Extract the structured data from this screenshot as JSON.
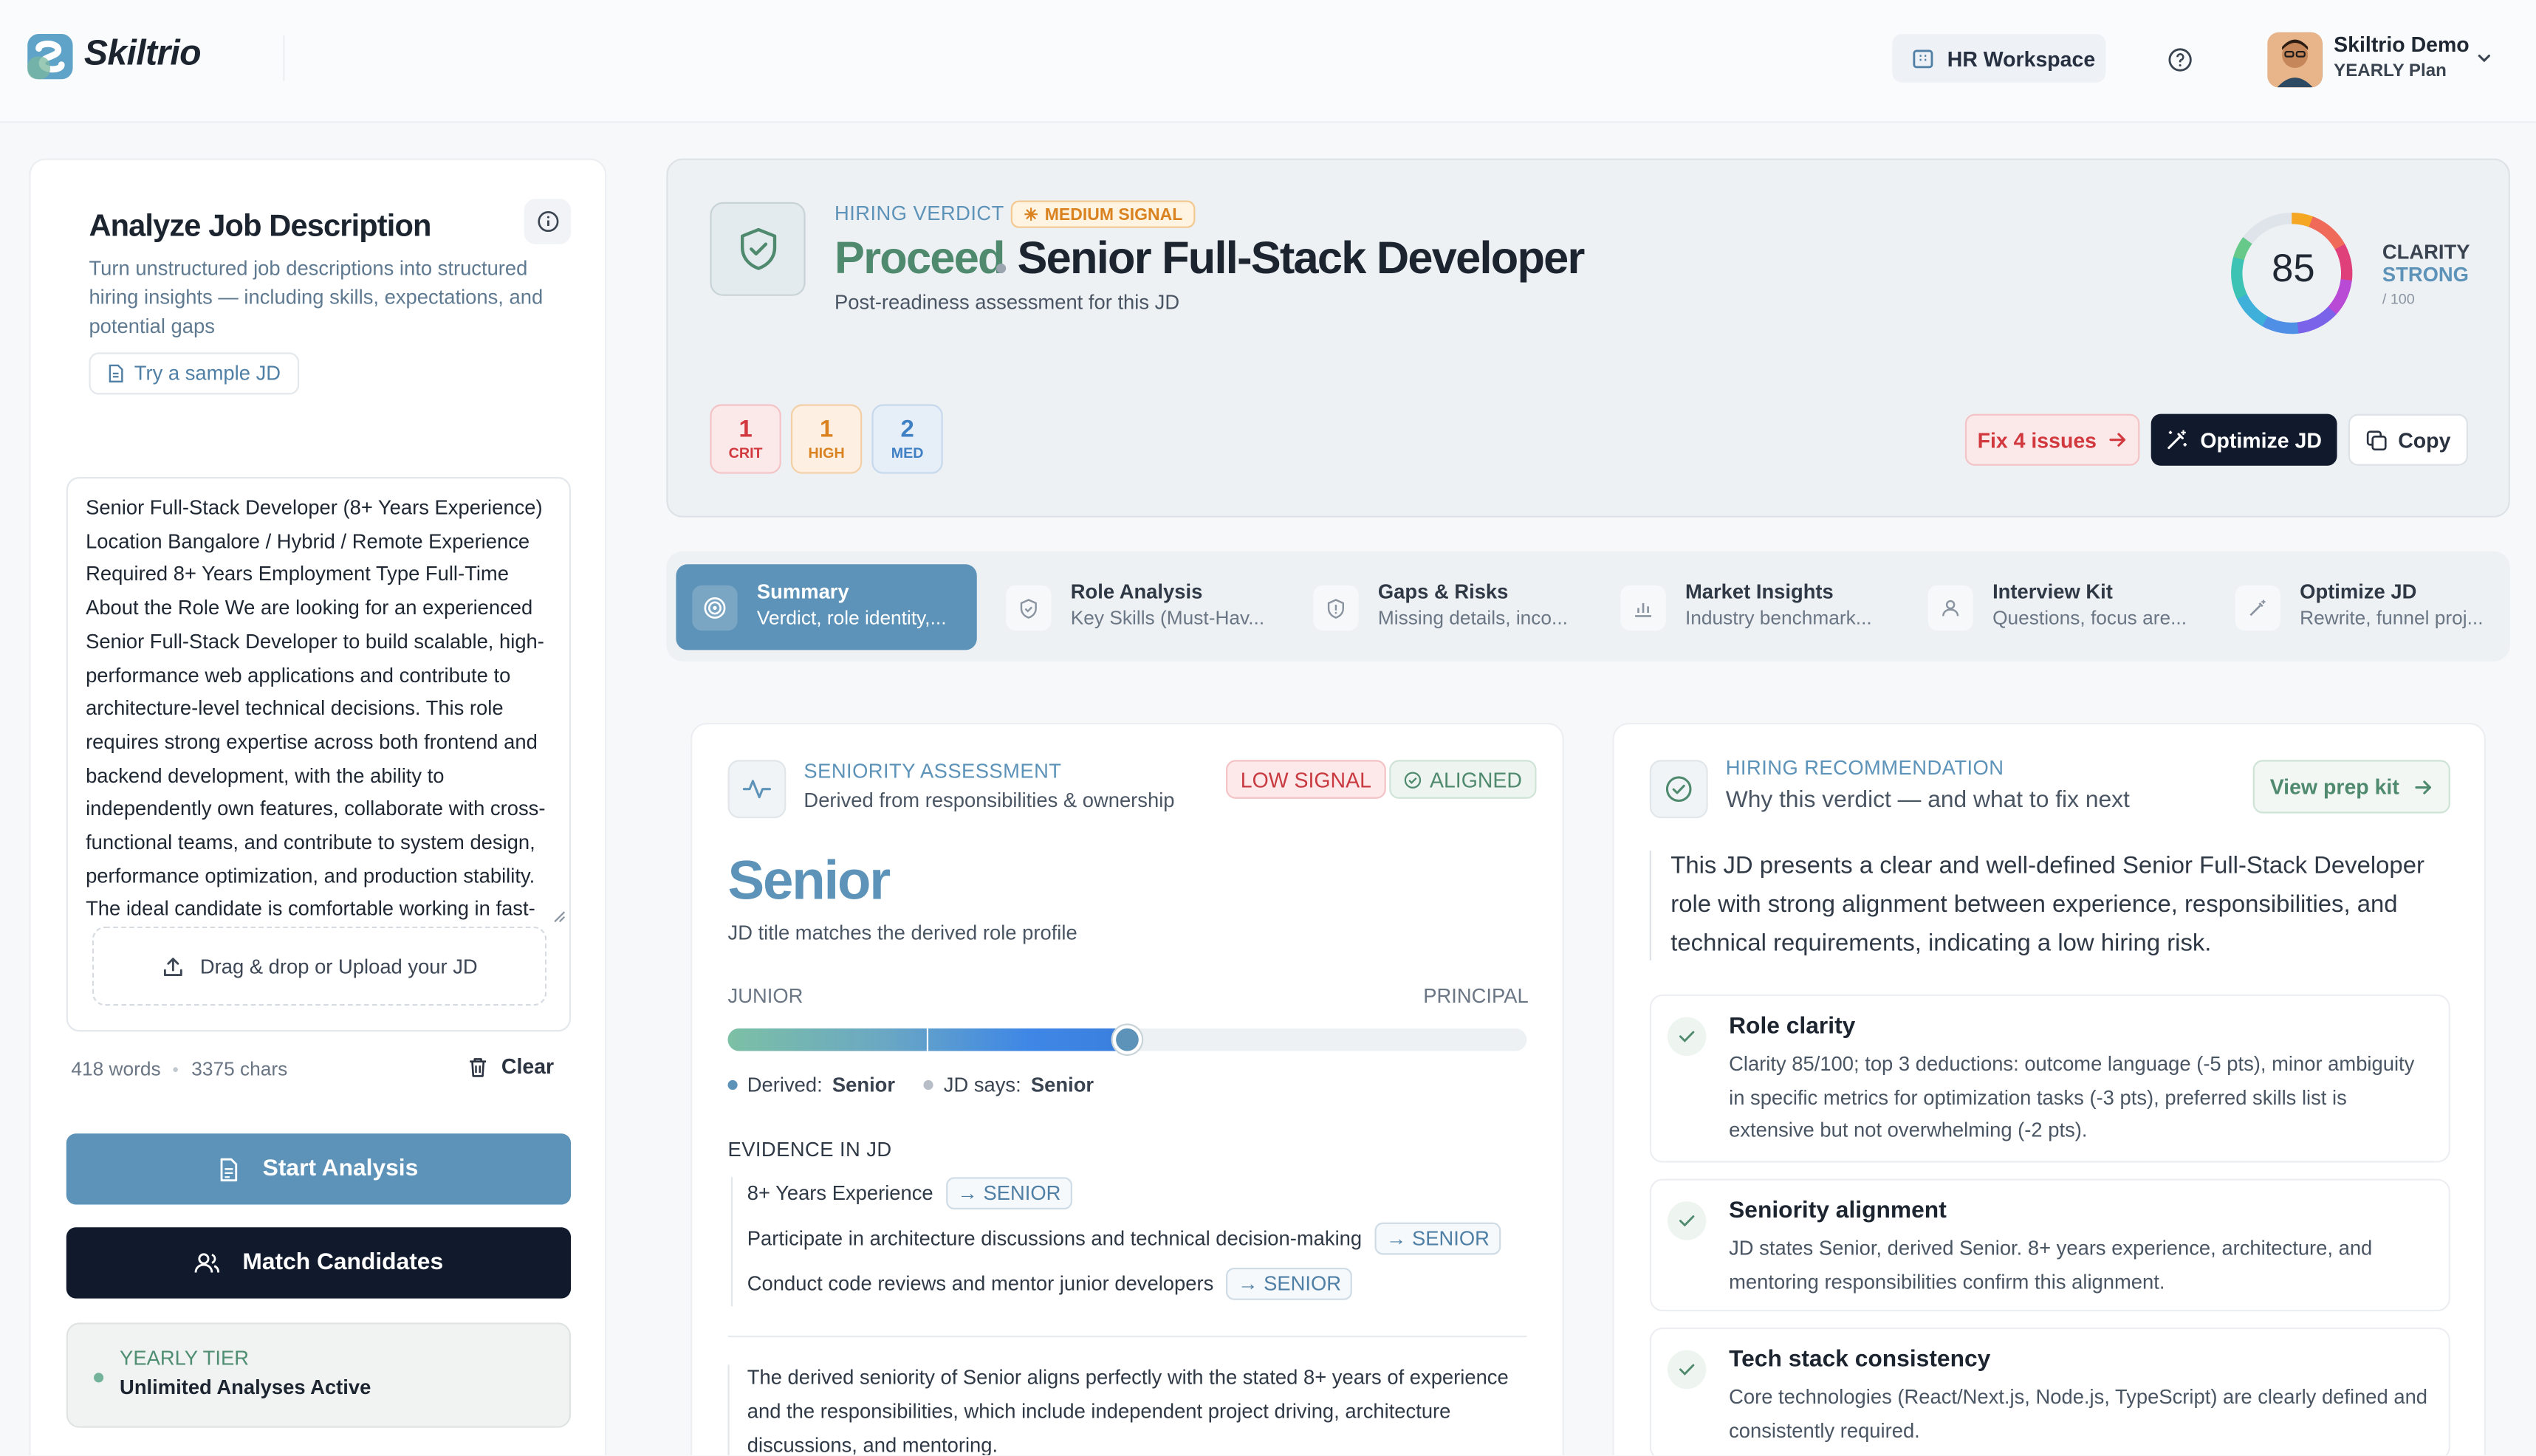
{
  "header": {
    "logo": "Skiltrio",
    "workspace_btn": "HR Workspace",
    "user_name": "Skiltrio Demo",
    "user_plan": "YEARLY Plan"
  },
  "left": {
    "title": "Analyze Job Description",
    "description": "Turn unstructured job descriptions into structured hiring insights — including skills, expectations, and potential gaps",
    "sample_btn": "Try a sample JD",
    "jd_text": "Senior Full-Stack Developer (8+ Years Experience) Location Bangalore / Hybrid / Remote Experience Required 8+ Years Employment Type Full-Time About the Role We are looking for an experienced Senior Full-Stack Developer to build scalable, high-performance web applications and contribute to architecture-level technical decisions. This role requires strong expertise across both frontend and backend development, with the ability to independently own features, collaborate with cross-functional teams, and contribute to system design, performance optimization, and production stability. The ideal candidate is comfortable working in fast-",
    "upload_label": "Drag & drop or Upload your JD",
    "word_count": "418 words",
    "char_count": "3375 chars",
    "clear_btn": "Clear",
    "start_btn": "Start Analysis",
    "match_btn": "Match Candidates",
    "tier_label": "YEARLY TIER",
    "tier_value": "Unlimited Analyses Active"
  },
  "verdict": {
    "label": "HIRING VERDICT",
    "signal": "MEDIUM SIGNAL",
    "decision": "Proceed",
    "role": "Senior Full-Stack Developer",
    "subtitle": "Post-readiness assessment for this JD",
    "clarity_score": 85,
    "clarity_max": 100,
    "clarity_label": "CLARITY",
    "clarity_rating": "STRONG",
    "clarity_denom": "/ 100",
    "severity": [
      {
        "count": "1",
        "label": "CRIT",
        "color": "#d2393f",
        "bg": "#fbe9ea",
        "border": "#f3c3c6"
      },
      {
        "count": "1",
        "label": "HIGH",
        "color": "#d9821f",
        "bg": "#fdefe2",
        "border": "#f3cfa6"
      },
      {
        "count": "2",
        "label": "MED",
        "color": "#3f7fc4",
        "bg": "#e6eff8",
        "border": "#c6d8ec"
      }
    ],
    "fix_btn": "Fix 4 issues",
    "optimize_btn": "Optimize JD",
    "copy_btn": "Copy"
  },
  "tabs": [
    {
      "title": "Summary",
      "subtitle": "Verdict, role identity,...",
      "icon": "target-icon",
      "active": true
    },
    {
      "title": "Role Analysis",
      "subtitle": "Key Skills (Must-Hav...",
      "icon": "shield-icon",
      "active": false
    },
    {
      "title": "Gaps & Risks",
      "subtitle": "Missing details, inco...",
      "icon": "shield-alert-icon",
      "active": false
    },
    {
      "title": "Market Insights",
      "subtitle": "Industry benchmark...",
      "icon": "bar-chart-icon",
      "active": false
    },
    {
      "title": "Interview Kit",
      "subtitle": "Questions, focus are...",
      "icon": "user-icon",
      "active": false
    },
    {
      "title": "Optimize JD",
      "subtitle": "Rewrite, funnel proj...",
      "icon": "wand-icon",
      "active": false
    }
  ],
  "seniority": {
    "label": "SENIORITY ASSESSMENT",
    "subtitle": "Derived from responsibilities & ownership",
    "signal_badge": "LOW SIGNAL",
    "aligned_badge": "ALIGNED",
    "level": "Senior",
    "level_sub": "JD title matches the derived role profile",
    "scale_low": "JUNIOR",
    "scale_high": "PRINCIPAL",
    "scale_fraction": 0.5,
    "derived_label": "Derived:",
    "derived_value": "Senior",
    "jd_says_label": "JD says:",
    "jd_says_value": "Senior",
    "evidence_heading": "EVIDENCE IN JD",
    "evidence": [
      {
        "text": "8+ Years Experience",
        "tag": "→ SENIOR"
      },
      {
        "text": "Participate in architecture discussions and technical decision-making",
        "tag": "→ SENIOR"
      },
      {
        "text": "Conduct code reviews and mentor junior developers",
        "tag": "→ SENIOR"
      }
    ],
    "summary": "The derived seniority of Senior aligns perfectly with the stated 8+ years of experience and the responsibilities, which include independent project driving, architecture discussions, and mentoring."
  },
  "recommendation": {
    "label": "HIRING RECOMMENDATION",
    "subtitle": "Why this verdict — and what to fix next",
    "prep_btn": "View prep kit",
    "text": "This JD presents a clear and well-defined Senior Full-Stack Developer role with strong alignment between experience, responsibilities, and technical requirements, indicating a low hiring risk.",
    "items": [
      {
        "title": "Role clarity",
        "desc": "Clarity 85/100; top 3 deductions: outcome language (-5 pts), minor ambiguity in specific metrics for optimization tasks (-3 pts), preferred skills list is extensive but not overwhelming (-2 pts)."
      },
      {
        "title": "Seniority alignment",
        "desc": "JD states Senior, derived Senior. 8+ years experience, architecture, and mentoring responsibilities confirm this alignment."
      },
      {
        "title": "Tech stack consistency",
        "desc": "Core technologies (React/Next.js, Node.js, TypeScript) are clearly defined and consistently required."
      }
    ]
  },
  "colors": {
    "accent": "#5d93b8",
    "dark": "#101a2c",
    "success": "#4f8a6e",
    "danger": "#d2393f",
    "warning": "#d9821f"
  }
}
